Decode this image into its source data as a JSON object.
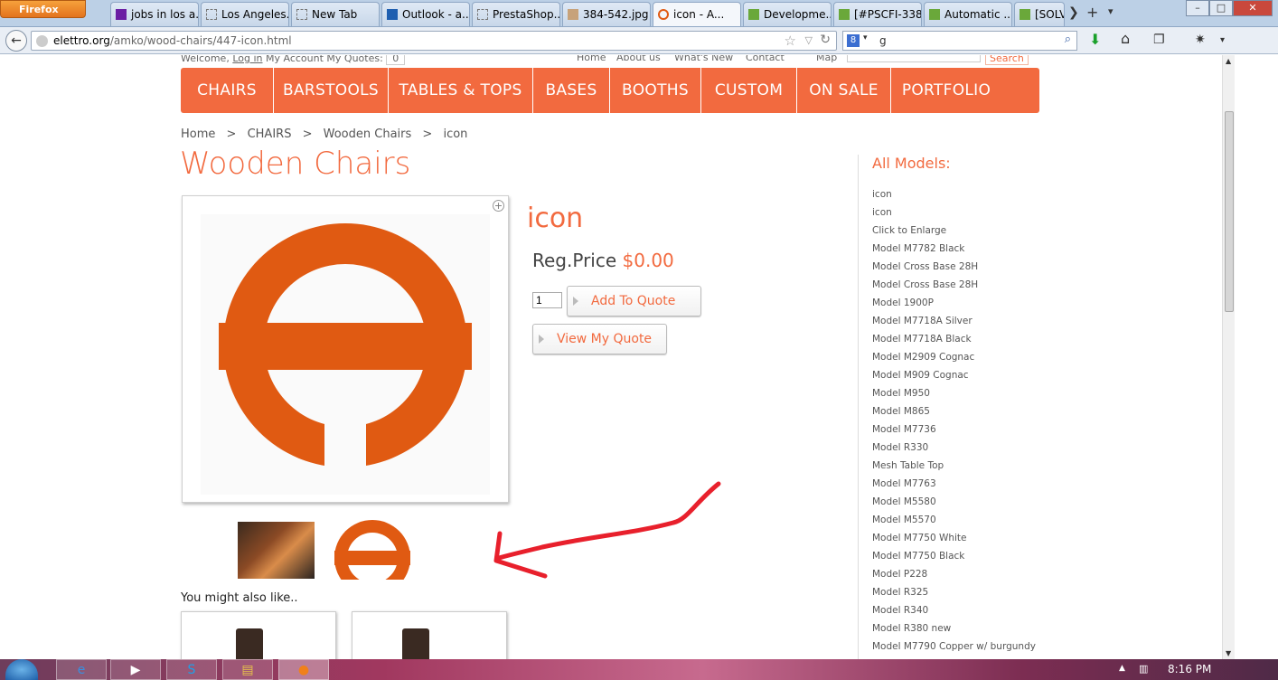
{
  "browser": {
    "menu_button": "Firefox",
    "tabs": [
      {
        "label": "jobs in los a..."
      },
      {
        "label": "Los Angeles..."
      },
      {
        "label": "New Tab"
      },
      {
        "label": "Outlook - a..."
      },
      {
        "label": "PrestaShop..."
      },
      {
        "label": "384-542.jpg ..."
      },
      {
        "label": "icon - A..."
      },
      {
        "label": "Developme..."
      },
      {
        "label": "[#PSCFI-338..."
      },
      {
        "label": "Automatic ..."
      },
      {
        "label": "[SOLV"
      }
    ],
    "url_domain": "elettro.org",
    "url_path": "/amko/wood-chairs/447-icon.html",
    "search_value": "g"
  },
  "header": {
    "welcome": "Welcome,",
    "login": "Log in",
    "my_account": "My Account",
    "my_quotes": "My Quotes:",
    "quote_count": "0",
    "links": [
      "Home",
      "About us",
      "What's New",
      "Contact",
      "Map"
    ],
    "search_button": "Search"
  },
  "menu": {
    "items": [
      "CHAIRS",
      "BARSTOOLS",
      "TABLES & TOPS",
      "BASES",
      "BOOTHS",
      "CUSTOM",
      "ON SALE",
      "PORTFOLIO"
    ]
  },
  "breadcrumb": {
    "items": [
      "Home",
      ">",
      "CHAIRS",
      ">",
      "Wooden Chairs",
      ">",
      "icon"
    ]
  },
  "page": {
    "title": "Wooden Chairs"
  },
  "product": {
    "name": "icon",
    "price_label": "Reg.Price",
    "price_value": "$0.00",
    "quantity": "1",
    "add_button": "Add To Quote",
    "view_button": "View My Quote",
    "also_like": "You might also like.."
  },
  "sidebar": {
    "title": "All Models:",
    "items": [
      "icon",
      "icon",
      "Click to Enlarge",
      "Model M7782 Black",
      "Model Cross Base 28H",
      "Model Cross Base 28H",
      "Model 1900P",
      "Model M7718A Silver",
      "Model M7718A Black",
      "Model M2909 Cognac",
      "Model M909 Cognac",
      "Model M950",
      "Model M865",
      "Model M7736",
      "Model R330",
      "Mesh Table Top",
      "Model M7763",
      "Model M5580",
      "Model M5570",
      "Model M7750 White",
      "Model M7750 Black",
      "Model P228",
      "Model R325",
      "Model R340",
      "Model R380 new",
      "Model M7790 Copper w/ burgundy"
    ]
  },
  "taskbar": {
    "clock": "8:16 PM"
  },
  "colors": {
    "brand": "#f26a3f",
    "logo": "#e05a12",
    "annotation": "#e8202c"
  }
}
